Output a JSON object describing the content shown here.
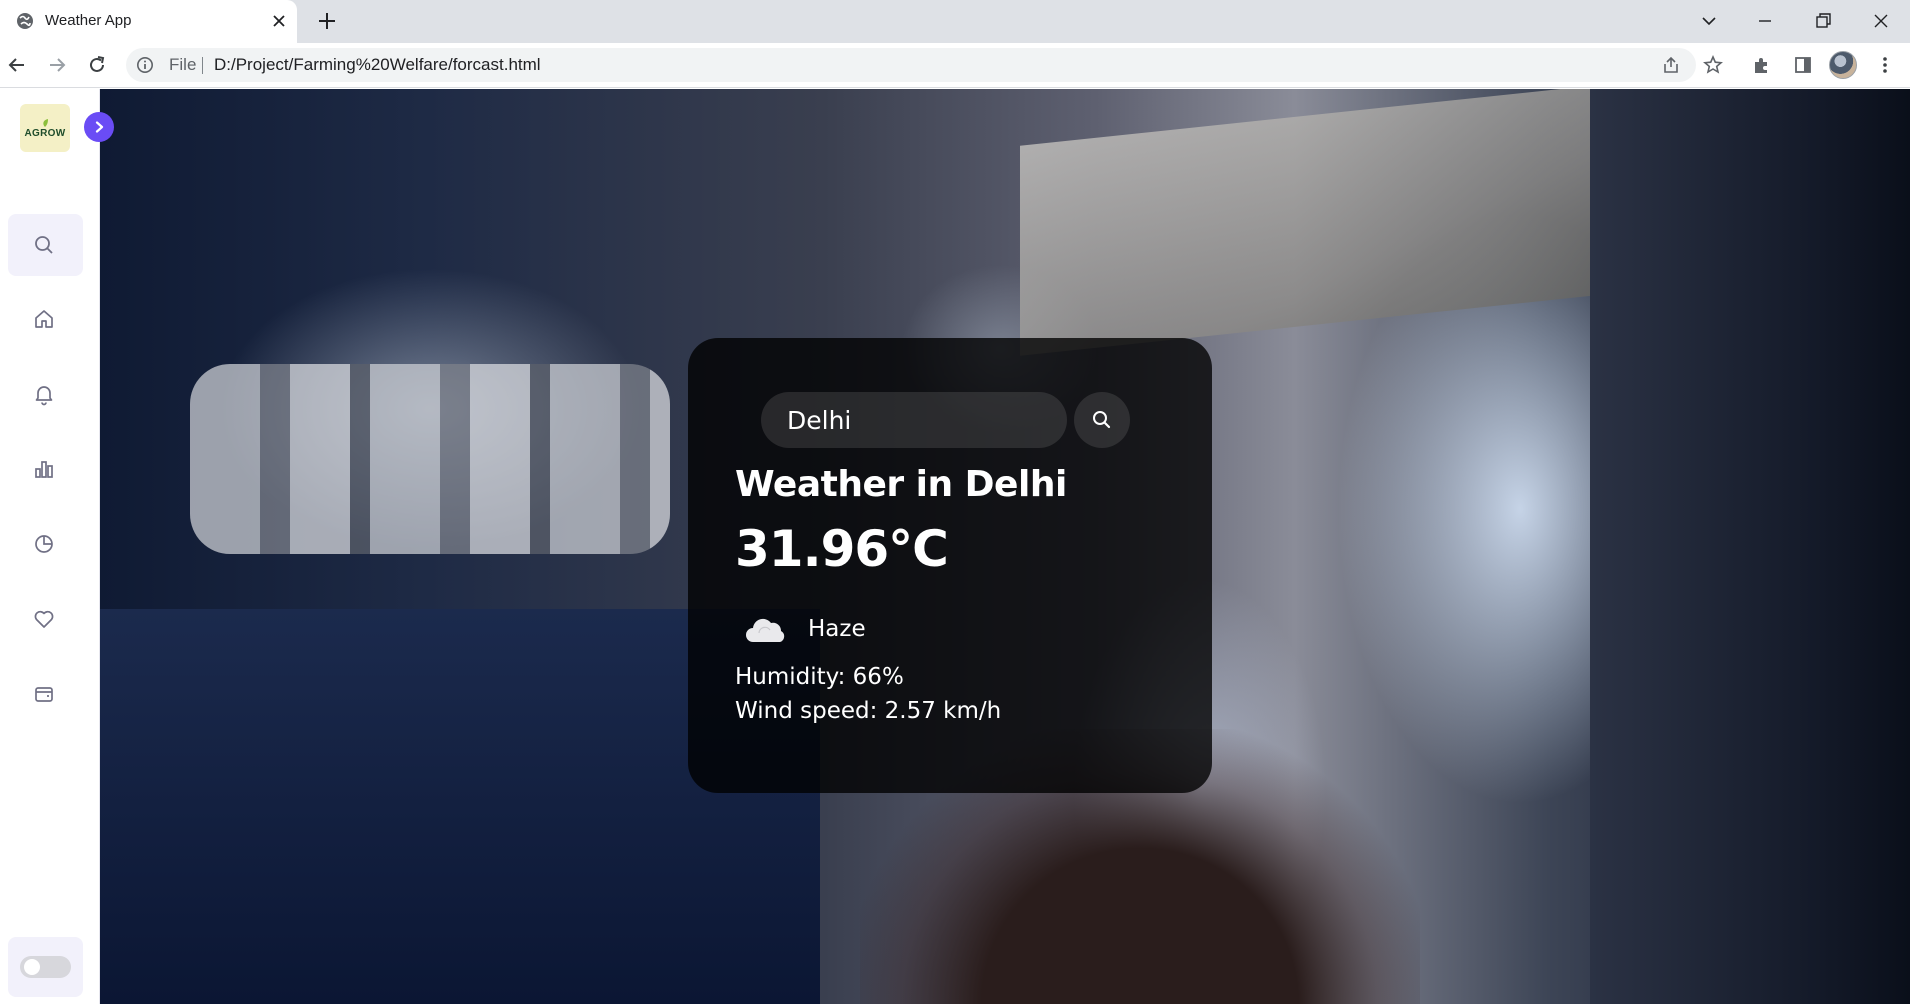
{
  "browser": {
    "tab_title": "Weather App",
    "omnibox": {
      "scheme_label": "File",
      "url": "D:/Project/Farming%20Welfare/forcast.html"
    }
  },
  "sidebar": {
    "logo_text": "AGROW",
    "items": [
      {
        "icon": "search-icon"
      },
      {
        "icon": "home-icon"
      },
      {
        "icon": "bell-icon"
      },
      {
        "icon": "bar-chart-icon"
      },
      {
        "icon": "pie-chart-icon"
      },
      {
        "icon": "heart-icon"
      },
      {
        "icon": "wallet-icon"
      }
    ],
    "theme_toggle_on": false
  },
  "weather": {
    "search_value": "Delhi",
    "city_title": "Weather in Delhi",
    "temperature": "31.96°C",
    "condition_icon": "cloud-icon",
    "condition": "Haze",
    "humidity": "Humidity: 66%",
    "wind": "Wind speed: 2.57 km/h"
  },
  "colors": {
    "accent": "#6a4cf5",
    "card_bg": "rgba(0,0,0,0.78)",
    "sidebar_bg": "#ffffff"
  }
}
